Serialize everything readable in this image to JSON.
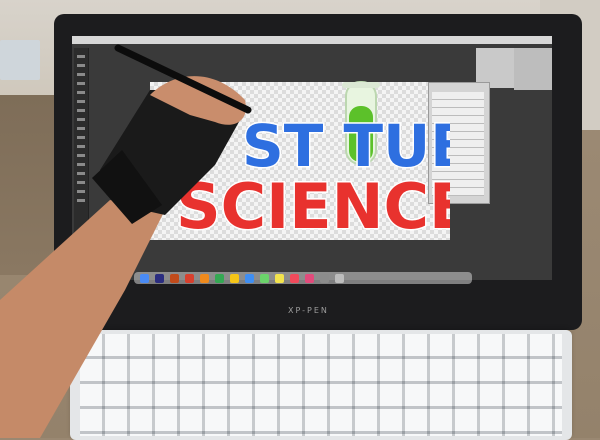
{
  "device": {
    "brand_label": "XP-PEN"
  },
  "artwork": {
    "headline_top": "ST TUBE",
    "headline_bottom": "SCIENCE"
  },
  "colors": {
    "desk": "#9a8872",
    "wall": "#d9d4cc",
    "bezel": "#1c1c1e",
    "screen": "#3a3a3a",
    "canvas_bg": "#f2f2f2",
    "keyboard": "#e7e9ea",
    "skin": "#c98d6c",
    "glove": "#1a1a1a",
    "tube_liquid": "#5cc12a",
    "letters": [
      "#e8322e",
      "#f6a41b",
      "#2e6fe0",
      "#f2cf1f",
      "#7bc043",
      "#f06a1c"
    ]
  },
  "dock": {
    "icons": [
      "finder-icon",
      "photoshop-icon",
      "illustrator-icon",
      "acrobat-icon",
      "firefox-icon",
      "chrome-icon",
      "photos-icon",
      "mail-icon",
      "messages-icon",
      "notes-icon",
      "calendar-icon",
      "music-icon",
      "settings-icon",
      "trash-icon"
    ]
  }
}
